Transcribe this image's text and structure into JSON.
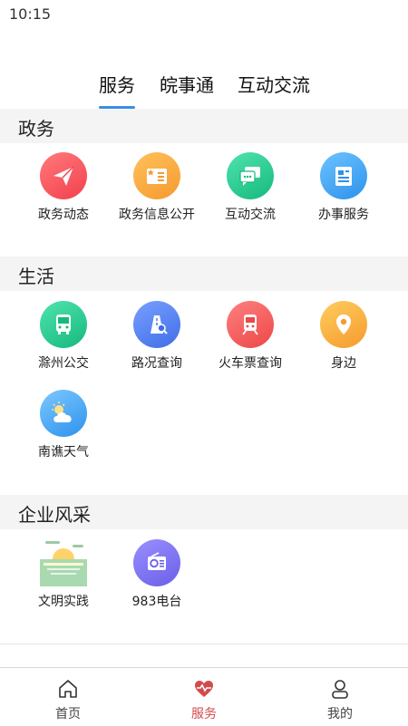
{
  "status_bar": {
    "time": "10:15"
  },
  "top_tabs": [
    {
      "label": "服务",
      "active": true
    },
    {
      "label": "皖事通",
      "active": false
    },
    {
      "label": "互动交流",
      "active": false
    }
  ],
  "sections": [
    {
      "title": "政务",
      "items": [
        {
          "label": "政务动态",
          "icon": "paper-plane-icon",
          "color": "#f5525c"
        },
        {
          "label": "政务信息公开",
          "icon": "news-book-icon",
          "color": "#f7a43a"
        },
        {
          "label": "互动交流",
          "icon": "chat-bubbles-icon",
          "color": "#23c98f"
        },
        {
          "label": "办事服务",
          "icon": "document-icon",
          "color": "#3ba4f3"
        }
      ]
    },
    {
      "title": "生活",
      "items": [
        {
          "label": "滁州公交",
          "icon": "bus-icon",
          "color": "#23c98f"
        },
        {
          "label": "路况查询",
          "icon": "road-search-icon",
          "color": "#4a7cf0"
        },
        {
          "label": "火车票查询",
          "icon": "train-icon",
          "color": "#f25f5f"
        },
        {
          "label": "身边",
          "icon": "location-pin-icon",
          "color": "#f7a43a"
        },
        {
          "label": "南谯天气",
          "icon": "weather-cloud-icon",
          "color": "#3ba4f3"
        }
      ]
    },
    {
      "title": "企业风采",
      "items": [
        {
          "label": "文明实践",
          "icon": "landscape-image-icon",
          "color": "#a8d8b0"
        },
        {
          "label": "983电台",
          "icon": "radio-icon",
          "color": "#7d73f0"
        }
      ]
    }
  ],
  "bottom_nav": [
    {
      "label": "首页",
      "icon": "home-icon",
      "active": false
    },
    {
      "label": "服务",
      "icon": "heart-pulse-icon",
      "active": true
    },
    {
      "label": "我的",
      "icon": "user-icon",
      "active": false
    }
  ],
  "colors": {
    "accent_tab": "#3a8ee6",
    "nav_active": "#d24b4b"
  }
}
